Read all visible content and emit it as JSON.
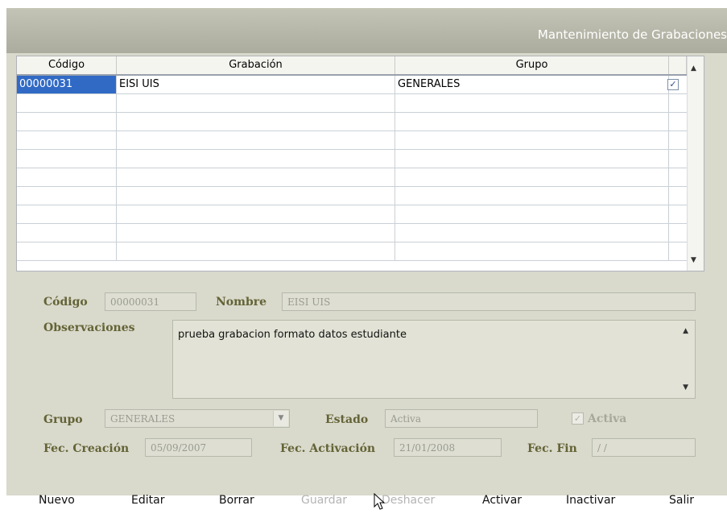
{
  "window": {
    "title": "Mantenimiento de Grabaciones"
  },
  "grid": {
    "columns": [
      "Código",
      "Grabación",
      "Grupo"
    ],
    "rows": [
      {
        "codigo": "00000031",
        "grabacion": "EISI UIS",
        "grupo": "GENERALES",
        "checked": true
      }
    ]
  },
  "form": {
    "codigo_label": "Código",
    "codigo_value": "00000031",
    "nombre_label": "Nombre",
    "nombre_value": "EISI UIS",
    "observaciones_label": "Observaciones",
    "observaciones_value": "prueba grabacion formato datos estudiante",
    "grupo_label": "Grupo",
    "grupo_value": "GENERALES",
    "estado_label": "Estado",
    "estado_value": "Activa",
    "activa_label": "Activa",
    "activa_checked": true,
    "fec_creacion_label": "Fec. Creación",
    "fec_creacion_value": "05/09/2007",
    "fec_activacion_label": "Fec. Activación",
    "fec_activacion_value": "21/01/2008",
    "fec_fin_label": "Fec. Fin",
    "fec_fin_value": " / /"
  },
  "toolbar": {
    "nuevo": "Nuevo",
    "editar": "Editar",
    "borrar": "Borrar",
    "guardar": "Guardar",
    "deshacer": "Deshacer",
    "activar": "Activar",
    "inactivar": "Inactivar",
    "salir": "Salir"
  },
  "colors": {
    "selection": "#316ac5",
    "label": "#636336",
    "panel": "#d9d9cc"
  }
}
